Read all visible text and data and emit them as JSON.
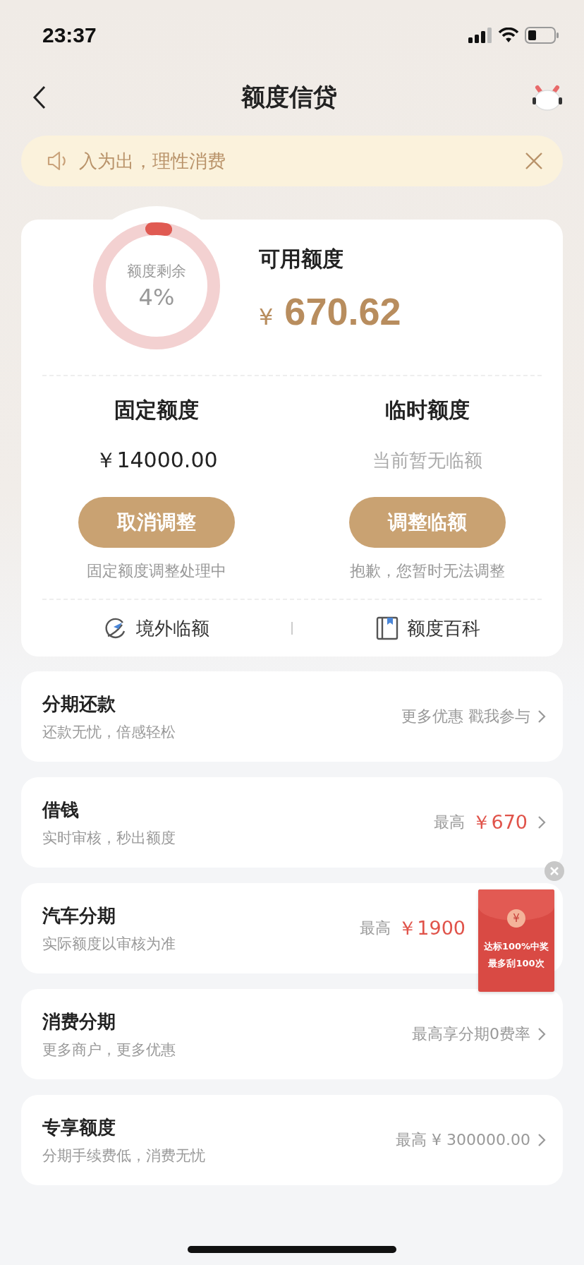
{
  "status_bar": {
    "time": "23:37"
  },
  "nav": {
    "title": "额度信贷"
  },
  "notice": {
    "text": "入为出，理性消费"
  },
  "credit": {
    "ring": {
      "label": "额度剩余",
      "percent": "4%",
      "level": 0.04
    },
    "available_label": "可用额度",
    "currency": "¥",
    "available_amount": "670.62",
    "columns": [
      {
        "title": "固定额度",
        "value": "￥14000.00",
        "kind": "amount",
        "button": "取消调整",
        "note": "固定额度调整处理中"
      },
      {
        "title": "临时额度",
        "value": "当前暂无临额",
        "kind": "empty",
        "button": "调整临额",
        "note": "抱歉，您暂时无法调整"
      }
    ],
    "links": [
      {
        "kind": "globe",
        "label": "境外临额"
      },
      {
        "kind": "book",
        "label": "额度百科"
      }
    ]
  },
  "services": [
    {
      "title": "分期还款",
      "subtitle": "还款无忧，倍感轻松",
      "value": "更多优惠 戳我参与",
      "kind": "plain"
    },
    {
      "title": "借钱",
      "subtitle": "实时审核，秒出额度",
      "prefix": "最高",
      "value": "￥670",
      "kind": "highlight"
    },
    {
      "title": "汽车分期",
      "subtitle": "实际额度以审核为准",
      "prefix": "最高",
      "value": "￥1900",
      "kind": "highlight",
      "promo": {
        "coin": "¥",
        "lines": [
          "达标100%中奖",
          "最多刮100次"
        ]
      }
    },
    {
      "title": "消费分期",
      "subtitle": "更多商户，更多优惠",
      "value": "最高享分期0费率",
      "kind": "plain"
    },
    {
      "title": "专享额度",
      "subtitle": "分期手续费低，消费无忧",
      "value": "最高 ¥ 300000.00",
      "kind": "plain"
    }
  ]
}
